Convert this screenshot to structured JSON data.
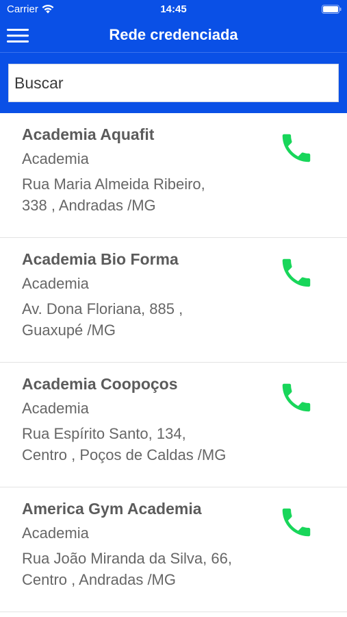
{
  "status_bar": {
    "carrier": "Carrier",
    "time": "14:45",
    "wifi_icon": "wifi-icon",
    "battery_icon": "battery-icon"
  },
  "nav": {
    "title": "Rede credenciada",
    "menu_icon": "hamburger-menu-icon"
  },
  "search": {
    "placeholder": "Buscar",
    "value": ""
  },
  "colors": {
    "header_blue": "#0a50e6",
    "phone_green": "#18d65a",
    "text_gray": "#666666",
    "name_gray": "#5b5b5b",
    "divider": "#e3e3e3"
  },
  "providers": [
    {
      "name": "Academia Aquafit",
      "category": "Academia",
      "address_line1": "Rua Maria Almeida Ribeiro,",
      "address_line2": "338 , Andradas /MG",
      "action_icon": "phone-icon"
    },
    {
      "name": "Academia Bio Forma",
      "category": "Academia",
      "address_line1": "Av. Dona Floriana, 885 ,",
      "address_line2": "Guaxupé /MG",
      "action_icon": "phone-icon"
    },
    {
      "name": "Academia Coopoços",
      "category": "Academia",
      "address_line1": "Rua Espírito Santo, 134,",
      "address_line2": "Centro , Poços de Caldas /MG",
      "action_icon": "phone-icon"
    },
    {
      "name": "America Gym Academia",
      "category": "Academia",
      "address_line1": "Rua João Miranda da Silva, 66,",
      "address_line2": "Centro , Andradas /MG",
      "action_icon": "phone-icon"
    }
  ]
}
